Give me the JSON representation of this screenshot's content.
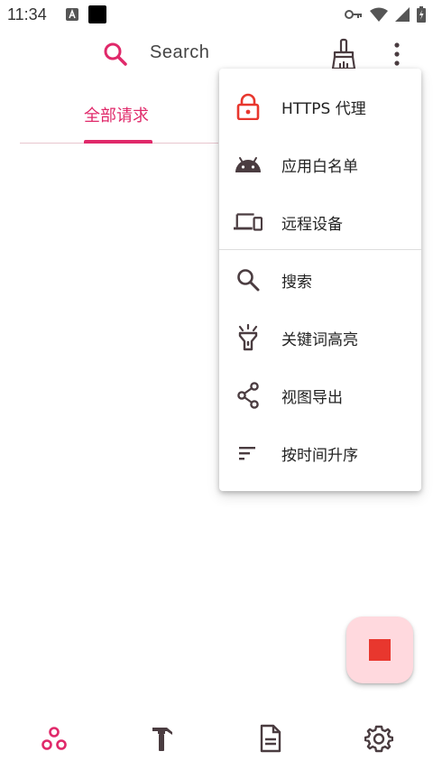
{
  "status_bar": {
    "time": "11:34",
    "icons": [
      "a-notification-icon",
      "black-square-icon",
      "key-icon",
      "wifi-icon",
      "signal-icon",
      "battery-charging-icon"
    ]
  },
  "app_bar": {
    "search_label": "Search",
    "icons": [
      "search-icon",
      "broom-icon",
      "more-vert-icon"
    ]
  },
  "tabs": [
    {
      "label": "全部请求",
      "selected": true
    }
  ],
  "overflow_menu": {
    "items": [
      {
        "icon": "lock-icon",
        "label": "HTTPS 代理"
      },
      {
        "icon": "android-icon",
        "label": "应用白名单"
      },
      {
        "icon": "devices-icon",
        "label": "远程设备"
      },
      {
        "icon": "search-icon",
        "label": "搜索"
      },
      {
        "icon": "highlight-icon",
        "label": "关键词高亮"
      },
      {
        "icon": "share-icon",
        "label": "视图导出"
      },
      {
        "icon": "sort-icon",
        "label": "按时间升序"
      }
    ]
  },
  "fab": {
    "icon": "stop-icon"
  },
  "bottom_nav": {
    "items": [
      {
        "icon": "bubbles-icon",
        "selected": true
      },
      {
        "icon": "hammer-icon",
        "selected": false
      },
      {
        "icon": "document-icon",
        "selected": false
      },
      {
        "icon": "settings-icon",
        "selected": false
      }
    ]
  },
  "colors": {
    "accent": "#e0296a",
    "icon_dark": "#4a3c40",
    "fab_bg": "#ffd9de",
    "fab_stop": "#e8372e",
    "lock_red": "#e8372e"
  }
}
